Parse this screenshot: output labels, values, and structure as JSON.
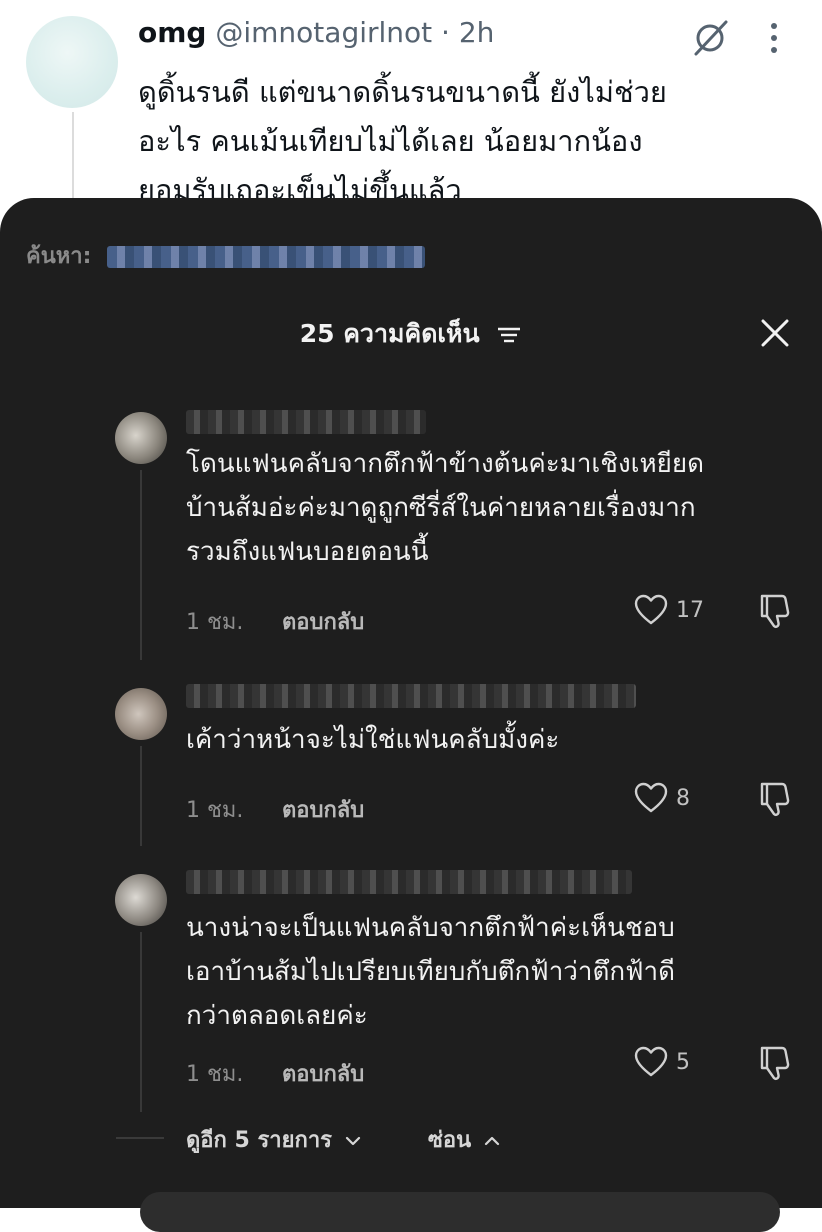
{
  "tweet": {
    "display_name": "omg",
    "handle": "@imnotagirlnot",
    "separator": " · ",
    "time": "2h",
    "lines": [
      "ดูดิ้นรนดี แต่ขนาดดิ้นรนขนาดนี้ ยังไม่ช่วย",
      "อะไร คนเม้นเทียบไม่ได้เลย น้อยมากน้อง",
      "ยอมรับเถอะเข็นไม่ขึ้นแล้ว"
    ]
  },
  "sheet": {
    "search_label": "ค้นหา:",
    "title": "25 ความคิดเห็น",
    "close_icon": "close-icon",
    "filter_icon": "filter-icon"
  },
  "comments": [
    {
      "lines": [
        "โดนแฟนคลับจากตึกฟ้าข้างต้นค่ะมาเชิงเหยียด",
        "บ้านส้มอ่ะค่ะมาดูถูกซีรี่ส์ในค่ายหลายเรื่องมาก",
        "รวมถึงแฟนบอยตอนนี้"
      ],
      "time": "1 ชม.",
      "reply_label": "ตอบกลับ",
      "likes": "17"
    },
    {
      "lines": [
        "เค้าว่าหน้าจะไม่ใช่แฟนคลับมั้งค่ะ"
      ],
      "time": "1 ชม.",
      "reply_label": "ตอบกลับ",
      "likes": "8"
    },
    {
      "lines": [
        "นางน่าจะเป็นแฟนคลับจากตึกฟ้าค่ะเห็นชอบ",
        "เอาบ้านส้มไปเปรียบเทียบกับตึกฟ้าว่าตึกฟ้าดี",
        "กว่าตลอดเลยค่ะ"
      ],
      "time": "1 ชม.",
      "reply_label": "ตอบกลับ",
      "likes": "5"
    }
  ],
  "footer": {
    "more_label": "ดูอีก 5 รายการ",
    "hide_label": "ซ่อน"
  },
  "colors": {
    "sheet_bg": "#1e1e1e",
    "text_primary": "#f2f2f2",
    "text_muted": "#8e8e8e"
  }
}
